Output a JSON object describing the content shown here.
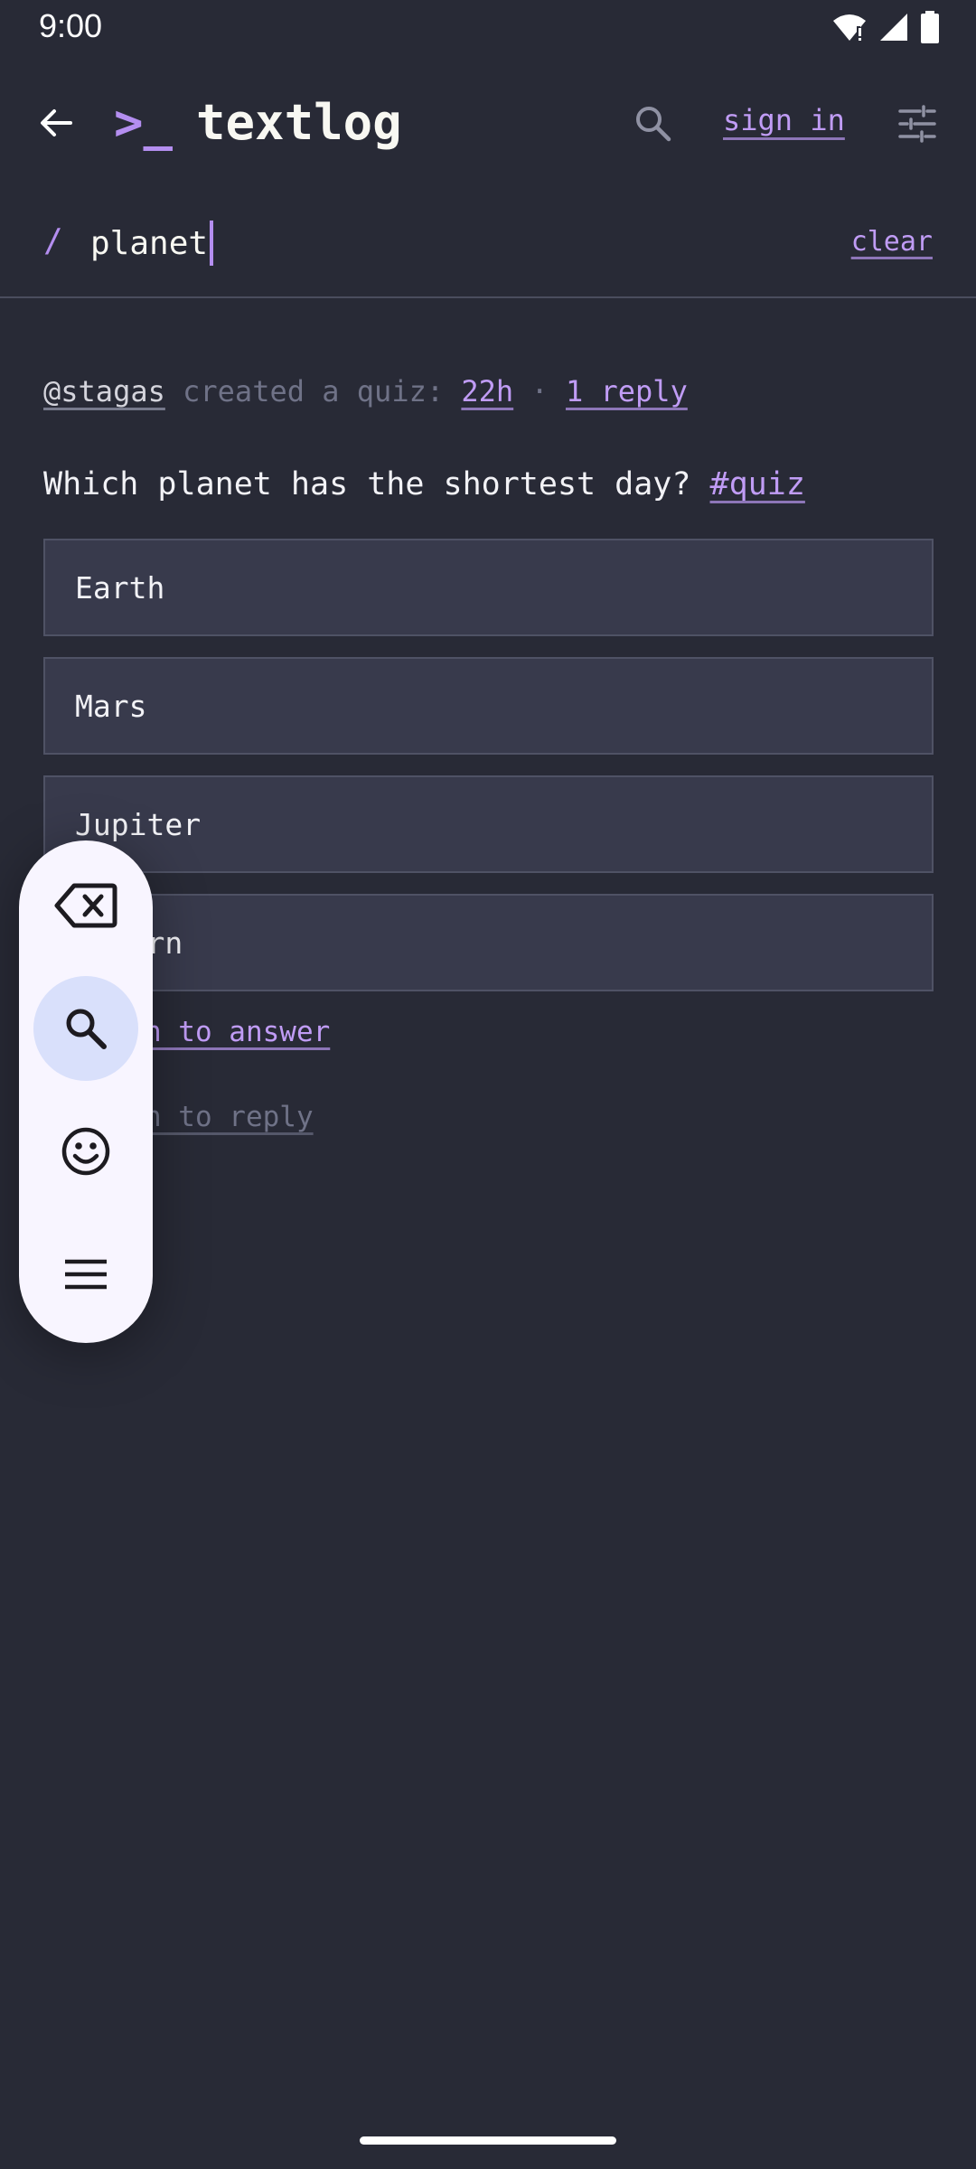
{
  "status_bar": {
    "time": "9:00"
  },
  "header": {
    "logo_prompt": ">_",
    "logo_name": "textlog",
    "sign_in_label": "sign in"
  },
  "search": {
    "prefix": "/",
    "value": "planet",
    "clear_label": "clear"
  },
  "post": {
    "author": "@stagas",
    "action": "created a quiz:",
    "age": "22h",
    "separator": "·",
    "replies": "1 reply",
    "question_text": "Which planet has the shortest day?",
    "tag": "#quiz",
    "options": [
      "Earth",
      "Mars",
      "Jupiter",
      "Saturn"
    ],
    "answer_link": "sign in to answer",
    "reply_link": "sign in to reply"
  },
  "toolbar": {
    "buttons": [
      "backspace-icon",
      "search-icon",
      "emoji-icon",
      "menu-icon"
    ],
    "active": "search-icon"
  },
  "colors": {
    "background": "#282a36",
    "accent": "#b48ef0",
    "option_bg": "#383a4c",
    "toolbar_bg": "#f8f5ff"
  }
}
